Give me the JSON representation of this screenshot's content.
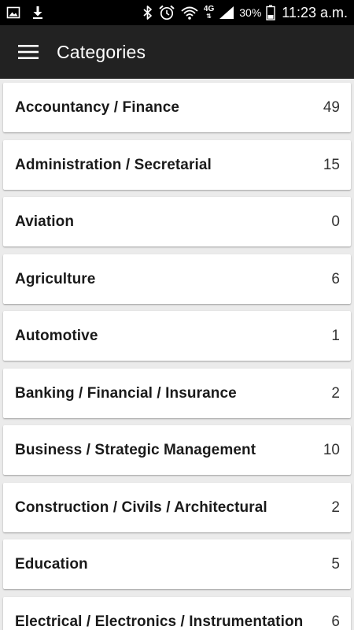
{
  "status_bar": {
    "icons": [
      "image-icon",
      "download-icon",
      "bluetooth-icon",
      "alarm-icon",
      "wifi-icon",
      "network-4g-icon",
      "signal-icon",
      "battery-icon"
    ],
    "network_type": "4G",
    "battery_percent": "30%",
    "time": "11:23 a.m."
  },
  "app_bar": {
    "menu_icon": "hamburger-menu-icon",
    "title": "Categories"
  },
  "categories": [
    {
      "label": "Accountancy / Finance",
      "count": "49"
    },
    {
      "label": "Administration / Secretarial",
      "count": "15"
    },
    {
      "label": "Aviation",
      "count": "0"
    },
    {
      "label": "Agriculture",
      "count": "6"
    },
    {
      "label": "Automotive",
      "count": "1"
    },
    {
      "label": "Banking / Financial / Insurance",
      "count": "2"
    },
    {
      "label": "Business / Strategic Management",
      "count": "10"
    },
    {
      "label": "Construction / Civils / Architectural",
      "count": "2"
    },
    {
      "label": "Education",
      "count": "5"
    },
    {
      "label": "Electrical / Electronics / Instrumentation",
      "count": "6"
    }
  ],
  "colors": {
    "status_bar_bg": "#000000",
    "app_bar_bg": "#222222",
    "list_bg": "#ebebeb",
    "card_bg": "#ffffff"
  }
}
